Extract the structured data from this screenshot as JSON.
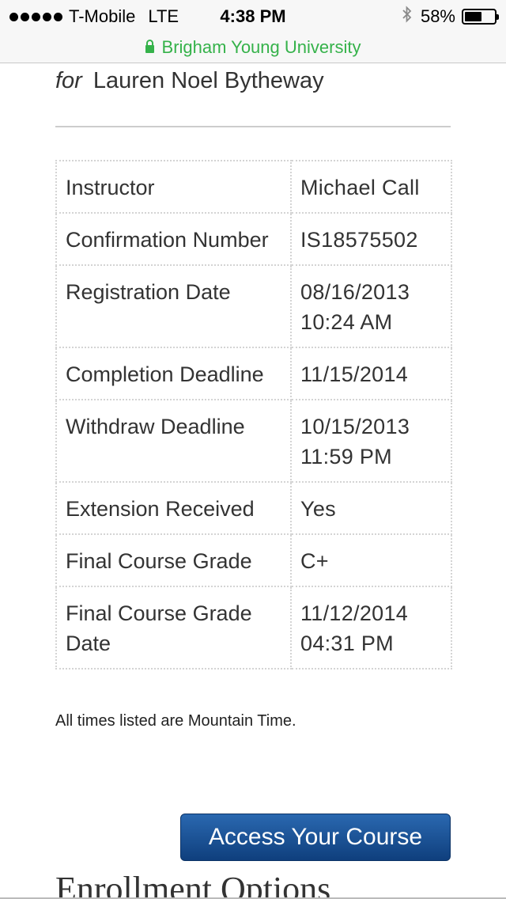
{
  "status_bar": {
    "carrier": "T-Mobile",
    "network": "LTE",
    "time": "4:38 PM",
    "battery_text": "58%",
    "battery_level": 0.58,
    "bluetooth_icon": "bluetooth-icon",
    "signal_icon": "signal-dots-icon"
  },
  "url_bar": {
    "site": "Brigham Young University",
    "lock_icon": "lock-icon",
    "color": "#35b24a"
  },
  "student": {
    "for_label": "for",
    "name": "Lauren Noel Bytheway"
  },
  "details": [
    {
      "label": "Instructor",
      "value": "Michael Call"
    },
    {
      "label": "Confirmation Number",
      "value": "IS18575502"
    },
    {
      "label": "Registration Date",
      "value": "08/16/2013 10:24 AM"
    },
    {
      "label": "Completion Deadline",
      "value": "11/15/2014"
    },
    {
      "label": "Withdraw Deadline",
      "value": "10/15/2013 11:59 PM"
    },
    {
      "label": "Extension Received",
      "value": "Yes"
    },
    {
      "label": "Final Course Grade",
      "value": "C+"
    },
    {
      "label": "Final Course Grade Date",
      "value": "11/12/2014 04:31 PM"
    }
  ],
  "timezone_note": "All times listed are Mountain Time.",
  "access_button": {
    "label": "Access Your Course",
    "color": "#1a4f91"
  },
  "enrollment_heading": "Enrollment Options"
}
